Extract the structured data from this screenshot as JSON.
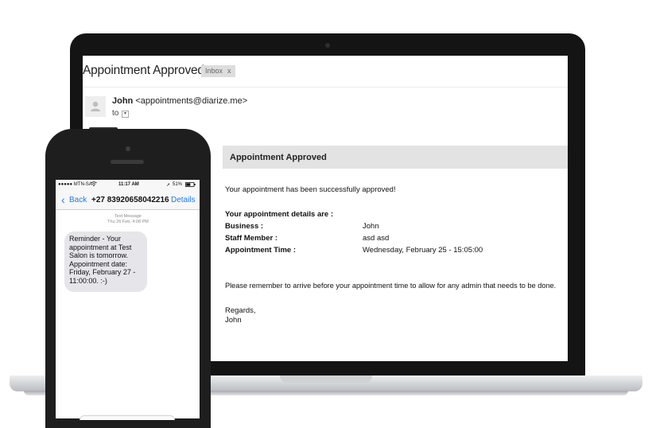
{
  "email": {
    "subject": "Appointment Approved",
    "badge": "Inbox",
    "badge_close": "x",
    "sender": {
      "name": "John",
      "address": "<appointments@diarize.me>"
    },
    "to_label": "to",
    "banner": "Appointment Approved",
    "intro": "Your appointment has been successfully approved!",
    "details_heading": "Your appointment details are :",
    "details": [
      {
        "label": "Business :",
        "value": "John"
      },
      {
        "label": "Staff Member :",
        "value": "asd asd"
      },
      {
        "label": "Appointment Time :",
        "value": "Wednesday, February 25 - 15:05:00"
      }
    ],
    "reminder": "Please remember to arrive before your appointment time to allow for any admin that needs to be done.",
    "closing": "Regards,",
    "signature": "John"
  },
  "phone": {
    "status": {
      "carrier": "●●●●● MTN-SA",
      "time": "11:17 AM",
      "battery": "51%"
    },
    "nav": {
      "back": "Back",
      "number": "+27 83920658042216",
      "details": "Details"
    },
    "meta_line1": "Text Message",
    "meta_line2": "Thu 26 Feb, 4:08 PM",
    "message": "Reminder - Your appointment at Test Salon is tomorrow. Appointment date: Friday, February 27 - 11:00:00. :-)"
  },
  "colors": {
    "ios_blue": "#1a7cf5",
    "bubble_gray": "#e5e5ea",
    "banner_gray": "#e3e3e3"
  },
  "icons": [
    "avatar-icon",
    "dropdown-icon",
    "back-chevron-icon",
    "wifi-icon",
    "location-icon",
    "battery-icon"
  ]
}
